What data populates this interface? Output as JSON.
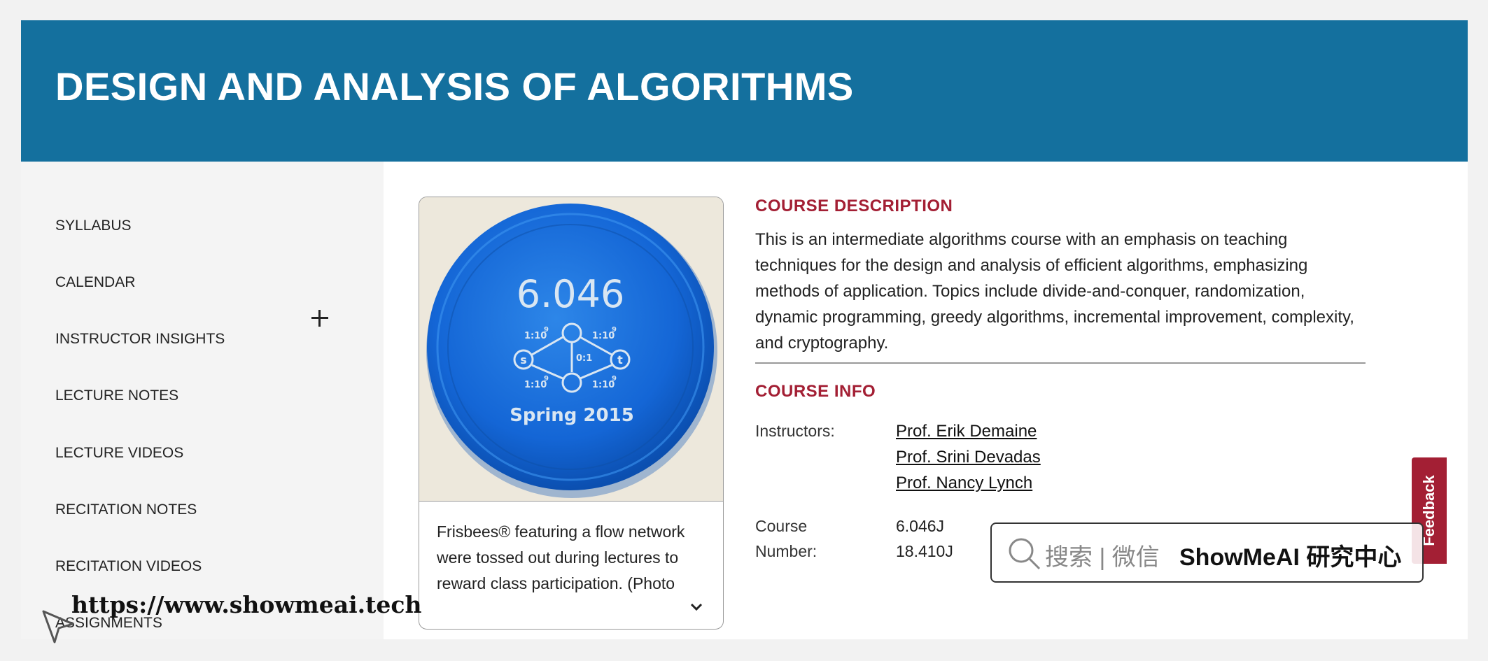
{
  "header": {
    "title": "DESIGN AND ANALYSIS OF ALGORITHMS",
    "background": "#14709e"
  },
  "sidebar": {
    "items": [
      {
        "label": "SYLLABUS"
      },
      {
        "label": "CALENDAR"
      },
      {
        "label": "INSTRUCTOR INSIGHTS",
        "expandable": true
      },
      {
        "label": "LECTURE NOTES"
      },
      {
        "label": "LECTURE VIDEOS"
      },
      {
        "label": "RECITATION NOTES"
      },
      {
        "label": "RECITATION VIDEOS"
      },
      {
        "label": "ASSIGNMENTS"
      }
    ],
    "expand_icon": "plus-icon"
  },
  "image_card": {
    "frisbee": {
      "course_number": "6.046",
      "term": "Spring 2015",
      "nodes": [
        "s",
        "t"
      ],
      "edge_labels": [
        "1:10",
        "1:10",
        "1:10",
        "1:10",
        "0:1"
      ],
      "exponent": "9"
    },
    "caption": "Frisbees® featuring a flow network were tossed out during lectures to reward class participation. (Photo",
    "expand_icon": "chevron-down-icon"
  },
  "course_description": {
    "title": "COURSE DESCRIPTION",
    "text": "This is an intermediate algorithms course with an emphasis on teaching techniques for the design and analysis of efficient algorithms, emphasizing methods of application. Topics include divide-and-conquer, randomization, dynamic programming, greedy algorithms, incremental improvement, complexity, and cryptography."
  },
  "course_info": {
    "title": "COURSE INFO",
    "instructors_label": "Instructors:",
    "instructors": [
      "Prof. Erik Demaine",
      "Prof. Srini Devadas",
      "Prof. Nancy Lynch"
    ],
    "course_number_label_1": "Course",
    "course_number_label_2": "Number:",
    "course_numbers": [
      "6.046J",
      "18.410J"
    ]
  },
  "feedback": {
    "label": "Feedback"
  },
  "watermark": {
    "search_text": "搜索 | 微信",
    "brand": "ShowMeAI 研究中心",
    "url": "https://www.showmeai.tech"
  },
  "colors": {
    "accent": "#a31f34",
    "header": "#14709e",
    "sidebar": "#f4f4f4"
  }
}
